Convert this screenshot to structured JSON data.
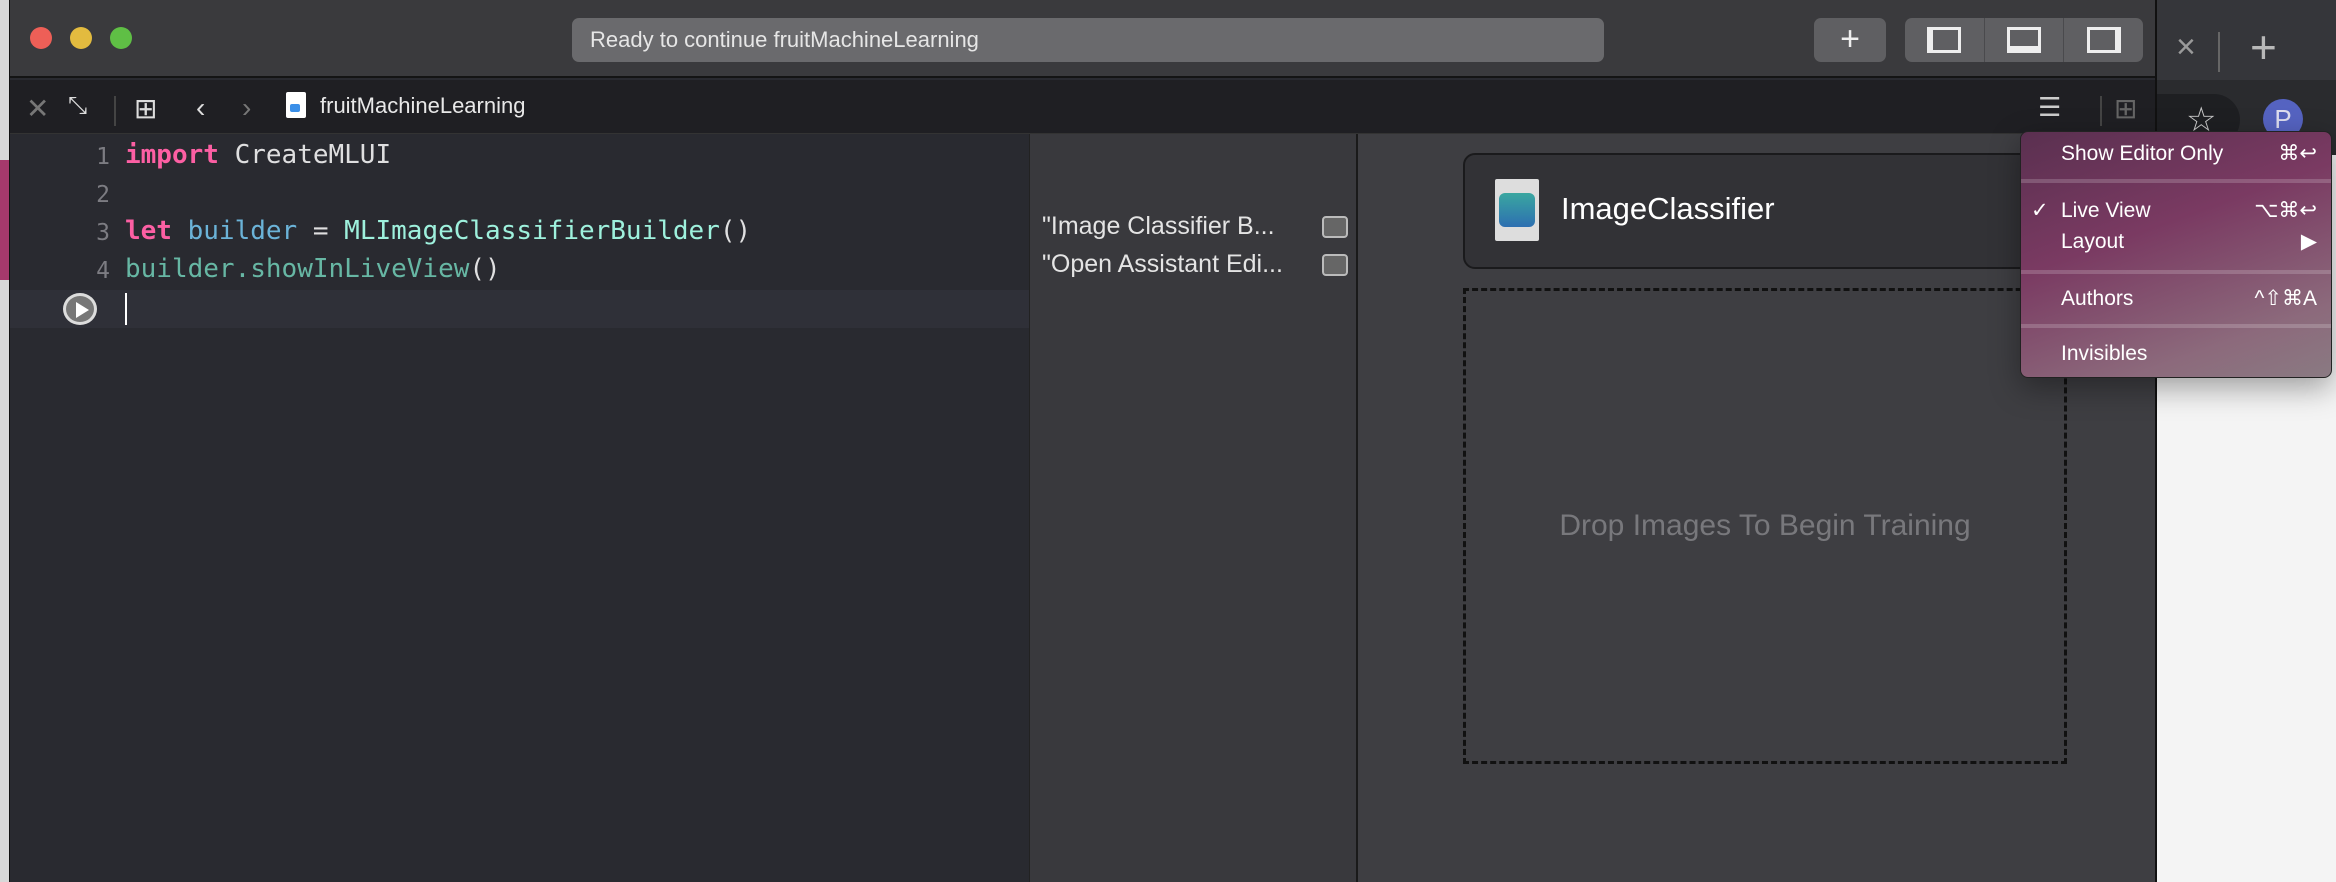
{
  "window": {
    "status": "Ready to continue fruitMachineLearning",
    "add_label": "+"
  },
  "tabbar": {
    "filename": "fruitMachineLearning"
  },
  "editor": {
    "line_numbers": [
      "1",
      "2",
      "3",
      "4"
    ],
    "lines": [
      [
        {
          "t": "import",
          "c": "kw"
        },
        {
          "t": " CreateMLUI",
          "c": ""
        }
      ],
      [],
      [
        {
          "t": "let",
          "c": "kw"
        },
        {
          "t": " ",
          "c": ""
        },
        {
          "t": "builder",
          "c": "var"
        },
        {
          "t": " = ",
          "c": ""
        },
        {
          "t": "MLImageClassifierBuilder",
          "c": "ty"
        },
        {
          "t": "()",
          "c": ""
        }
      ],
      [
        {
          "t": "builder.",
          "c": "fn"
        },
        {
          "t": "showInLiveView",
          "c": "fn"
        },
        {
          "t": "()",
          "c": ""
        }
      ]
    ]
  },
  "results": [
    "\"Image Classifier B...",
    "\"Open Assistant Edi..."
  ],
  "live_view": {
    "title": "ImageClassifier",
    "drop_text": "Drop Images To Begin Training"
  },
  "menu": {
    "items": [
      {
        "label": "Show Editor Only",
        "shortcut": "⌘↩",
        "checked": false
      },
      {
        "label": "Live View",
        "shortcut": "⌥⌘↩",
        "checked": true
      },
      {
        "label": "Layout",
        "shortcut": "▶",
        "checked": false
      },
      {
        "label": "Authors",
        "shortcut": "^⇧⌘A",
        "checked": false
      },
      {
        "label": "Invisibles",
        "shortcut": "",
        "checked": false
      }
    ],
    "check": "✓"
  },
  "browser": {
    "avatar": "P",
    "close": "×",
    "plus": "+",
    "star": "☆"
  },
  "colors": {
    "keyword": "#fc5fa3",
    "type": "#9ef1dd",
    "variable": "#6bb3d8",
    "method": "#67b7a4",
    "menu": "#7a3a62"
  }
}
